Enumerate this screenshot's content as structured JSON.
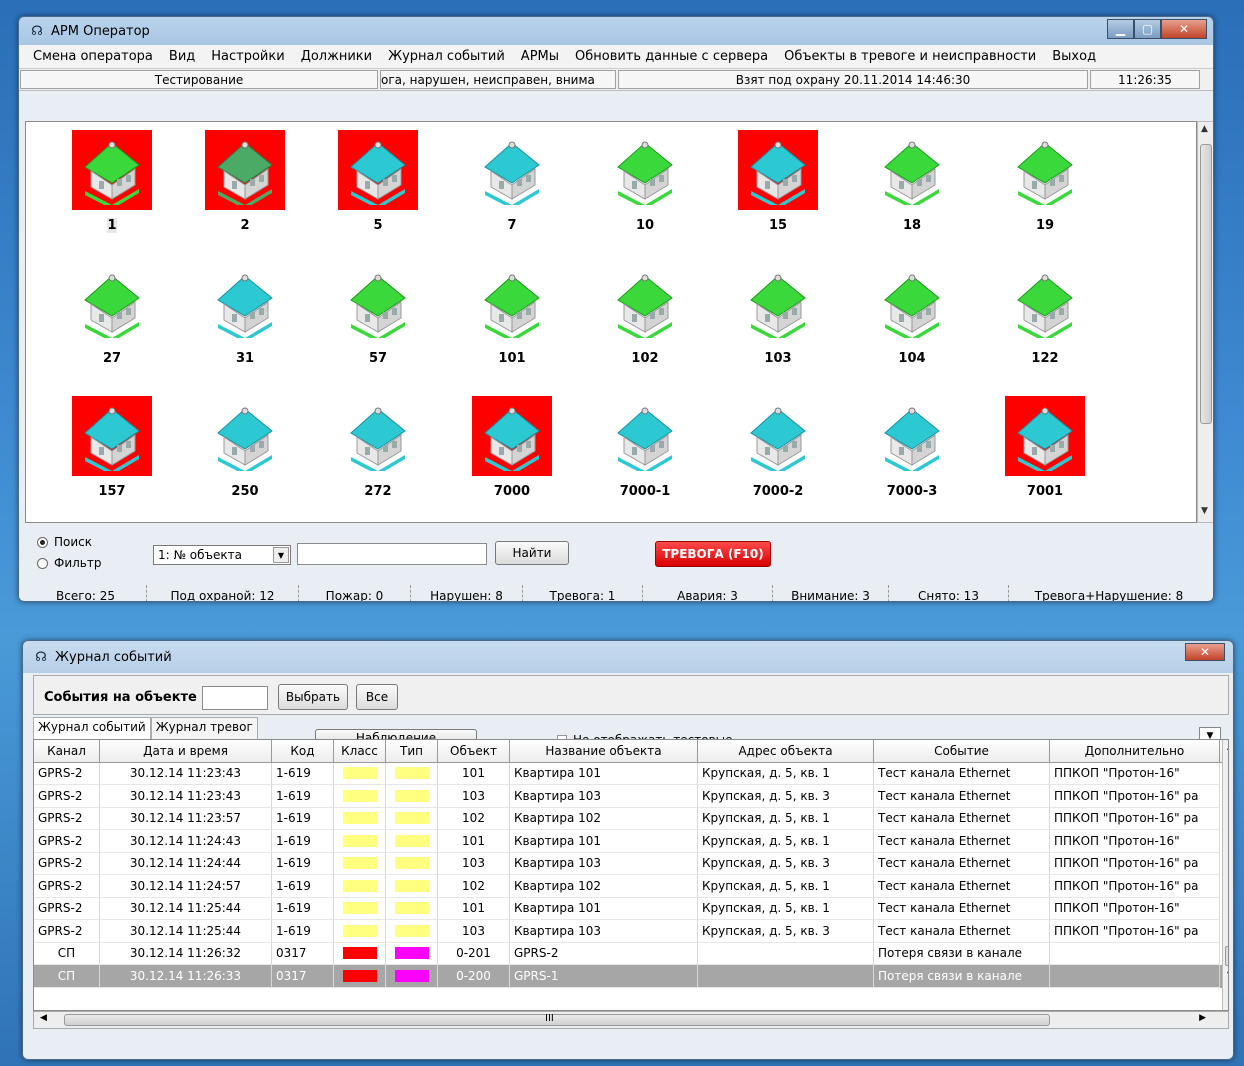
{
  "main_window": {
    "title": "АРМ Оператор",
    "menu": [
      "Смена оператора",
      "Вид",
      "Настройки",
      "Должники",
      "Журнал событий",
      "АРМы",
      "Обновить данные с сервера",
      "Объекты в тревоге и неисправности",
      "Выход"
    ],
    "status": {
      "mode": "Тестирование",
      "ticker": "ога, нарушен, неисправен, внима",
      "event": "Взят под охрану 20.11.2014 14:46:30",
      "time": "11:26:35"
    },
    "objects": [
      {
        "num": "1",
        "alarm": true,
        "roof": "green"
      },
      {
        "num": "2",
        "alarm": true,
        "roof": "dkgreen"
      },
      {
        "num": "5",
        "alarm": true,
        "roof": "teal"
      },
      {
        "num": "7",
        "alarm": false,
        "roof": "teal"
      },
      {
        "num": "10",
        "alarm": false,
        "roof": "green"
      },
      {
        "num": "15",
        "alarm": true,
        "roof": "teal"
      },
      {
        "num": "18",
        "alarm": false,
        "roof": "green"
      },
      {
        "num": "19",
        "alarm": false,
        "roof": "green"
      },
      {
        "num": "27",
        "alarm": false,
        "roof": "green"
      },
      {
        "num": "31",
        "alarm": false,
        "roof": "teal"
      },
      {
        "num": "57",
        "alarm": false,
        "roof": "green"
      },
      {
        "num": "101",
        "alarm": false,
        "roof": "green"
      },
      {
        "num": "102",
        "alarm": false,
        "roof": "green"
      },
      {
        "num": "103",
        "alarm": false,
        "roof": "green"
      },
      {
        "num": "104",
        "alarm": false,
        "roof": "green"
      },
      {
        "num": "122",
        "alarm": false,
        "roof": "green"
      },
      {
        "num": "157",
        "alarm": true,
        "roof": "teal"
      },
      {
        "num": "250",
        "alarm": false,
        "roof": "teal"
      },
      {
        "num": "272",
        "alarm": false,
        "roof": "teal"
      },
      {
        "num": "7000",
        "alarm": true,
        "roof": "teal"
      },
      {
        "num": "7000-1",
        "alarm": false,
        "roof": "teal"
      },
      {
        "num": "7000-2",
        "alarm": false,
        "roof": "teal"
      },
      {
        "num": "7000-3",
        "alarm": false,
        "roof": "teal"
      },
      {
        "num": "7001",
        "alarm": true,
        "roof": "teal"
      }
    ],
    "search": {
      "radio_search": "Поиск",
      "radio_filter": "Фильтр",
      "combo_value": "1: № объекта",
      "find_button": "Найти",
      "alarm_button": "ТРЕВОГА (F10)"
    },
    "counters": [
      "Всего: 25",
      "Под охраной: 12",
      "Пожар: 0",
      "Нарушен: 8",
      "Тревога: 1",
      "Авария: 3",
      "Внимание: 3",
      "Снято: 13",
      "Тревога+Нарушение: 8"
    ]
  },
  "journal_window": {
    "title": "Журнал событий",
    "events_label": "События на объекте",
    "select_button": "Выбрать",
    "all_button": "Все",
    "tabs": [
      "Журнал событий",
      "Журнал тревог"
    ],
    "watch_button": "Наблюдение",
    "hide_test_label": "Не отображать тестовые",
    "columns": [
      "Канал",
      "Дата и время",
      "Код",
      "Класс",
      "Тип",
      "Объект",
      "Название объекта",
      "Адрес объекта",
      "Событие",
      "Дополнительно"
    ],
    "rows": [
      {
        "channel": "GPRS-2",
        "datetime": "30.12.14  11:23:43",
        "code": "1-619",
        "cls": "#ffff80",
        "type": "#ffff80",
        "obj": "101",
        "name": "Квартира 101",
        "addr": "Крупская, д. 5, кв. 1",
        "event": "Тест канала Ethernet",
        "extra": "ППКОП \"Протон-16\""
      },
      {
        "channel": "GPRS-2",
        "datetime": "30.12.14  11:23:43",
        "code": "1-619",
        "cls": "#ffff80",
        "type": "#ffff80",
        "obj": "103",
        "name": "Квартира 103",
        "addr": "Крупская, д. 5, кв. 3",
        "event": "Тест канала Ethernet",
        "extra": "ППКОП \"Протон-16\" ра"
      },
      {
        "channel": "GPRS-2",
        "datetime": "30.12.14  11:23:57",
        "code": "1-619",
        "cls": "#ffff80",
        "type": "#ffff80",
        "obj": "102",
        "name": "Квартира 102",
        "addr": "Крупская, д. 5, кв. 1",
        "event": "Тест канала Ethernet",
        "extra": "ППКОП \"Протон-16\" ра"
      },
      {
        "channel": "GPRS-2",
        "datetime": "30.12.14  11:24:43",
        "code": "1-619",
        "cls": "#ffff80",
        "type": "#ffff80",
        "obj": "101",
        "name": "Квартира 101",
        "addr": "Крупская, д. 5, кв. 1",
        "event": "Тест канала Ethernet",
        "extra": "ППКОП \"Протон-16\""
      },
      {
        "channel": "GPRS-2",
        "datetime": "30.12.14  11:24:44",
        "code": "1-619",
        "cls": "#ffff80",
        "type": "#ffff80",
        "obj": "103",
        "name": "Квартира 103",
        "addr": "Крупская, д. 5, кв. 3",
        "event": "Тест канала Ethernet",
        "extra": "ППКОП \"Протон-16\" ра"
      },
      {
        "channel": "GPRS-2",
        "datetime": "30.12.14  11:24:57",
        "code": "1-619",
        "cls": "#ffff80",
        "type": "#ffff80",
        "obj": "102",
        "name": "Квартира 102",
        "addr": "Крупская, д. 5, кв. 1",
        "event": "Тест канала Ethernet",
        "extra": "ППКОП \"Протон-16\" ра"
      },
      {
        "channel": "GPRS-2",
        "datetime": "30.12.14  11:25:44",
        "code": "1-619",
        "cls": "#ffff80",
        "type": "#ffff80",
        "obj": "101",
        "name": "Квартира 101",
        "addr": "Крупская, д. 5, кв. 1",
        "event": "Тест канала Ethernet",
        "extra": "ППКОП \"Протон-16\""
      },
      {
        "channel": "GPRS-2",
        "datetime": "30.12.14  11:25:44",
        "code": "1-619",
        "cls": "#ffff80",
        "type": "#ffff80",
        "obj": "103",
        "name": "Квартира 103",
        "addr": "Крупская, д. 5, кв. 3",
        "event": "Тест канала Ethernet",
        "extra": "ППКОП \"Протон-16\" ра"
      },
      {
        "channel": "СП",
        "datetime": "30.12.14  11:26:32",
        "code": "0317",
        "cls": "#ff0000",
        "type": "#ff00ff",
        "obj": "0-201",
        "name": "GPRS-2",
        "addr": "",
        "event": "Потеря связи в канале",
        "extra": ""
      },
      {
        "channel": "СП",
        "datetime": "30.12.14  11:26:33",
        "code": "0317",
        "cls": "#ff0000",
        "type": "#ff00ff",
        "obj": "0-200",
        "name": "GPRS-1",
        "addr": "",
        "event": "Потеря связи в канале",
        "extra": "",
        "selected": true
      }
    ],
    "hscroll_mark": "III"
  },
  "colors": {
    "alarm": "#ff0000",
    "selected_row": "#a6a6a6",
    "alarm_button": "#e00000"
  }
}
